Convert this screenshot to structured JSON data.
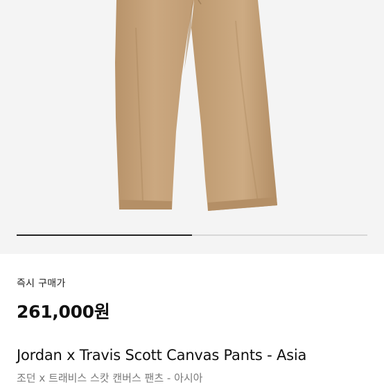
{
  "product": {
    "image_alt": "Khaki canvas pants",
    "buy_now_label": "즉시 구매가",
    "price": "261,000원",
    "name_en": "Jordan x Travis Scott Canvas Pants - Asia",
    "name_ko": "조던 x 트래비스 스캇 캔버스 팬츠 - 아시아"
  },
  "gallery": {
    "progress": 0.5
  },
  "colors": {
    "pants": "#c9a57c",
    "indicator_active": "#222222",
    "indicator_track": "#d7d7d7"
  }
}
